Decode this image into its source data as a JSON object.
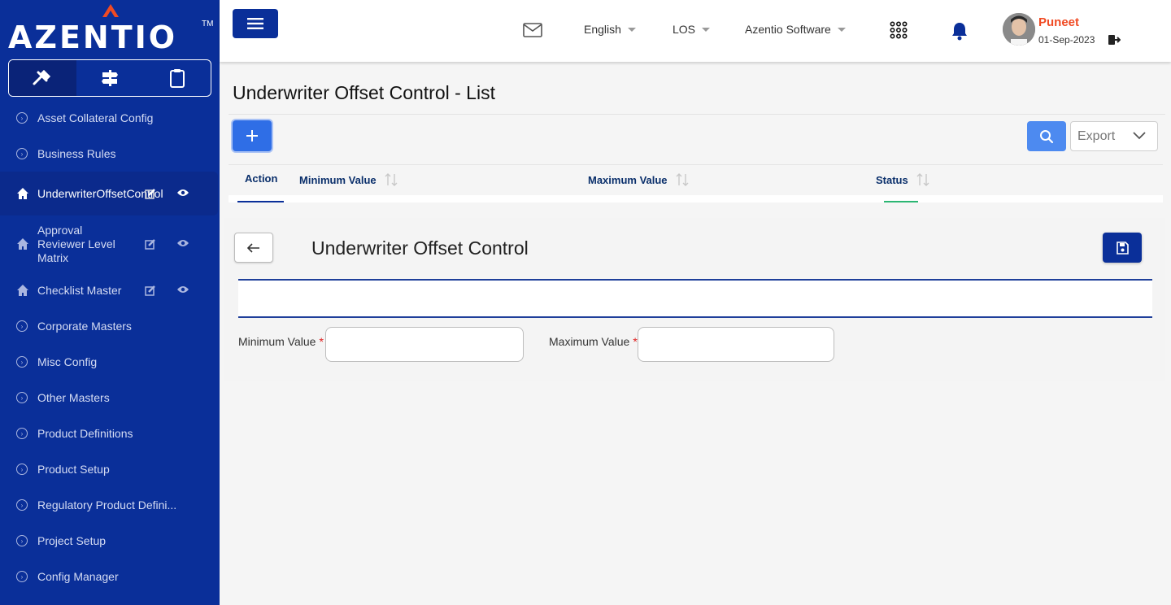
{
  "brand": {
    "name": "AZENTIO",
    "tm": "TM"
  },
  "sidebar": {
    "items": [
      {
        "label": "Asset Collateral Config"
      },
      {
        "label": "Business Rules"
      },
      {
        "label": "UnderwriterOffsetControl"
      },
      {
        "label": "Approval Reviewer Level Matrix"
      },
      {
        "label": "Checklist Master"
      },
      {
        "label": "Corporate Masters"
      },
      {
        "label": "Misc Config"
      },
      {
        "label": "Other Masters"
      },
      {
        "label": "Product Definitions"
      },
      {
        "label": "Product Setup"
      },
      {
        "label": "Regulatory Product Defini..."
      },
      {
        "label": "Project Setup"
      },
      {
        "label": "Config Manager"
      }
    ]
  },
  "header": {
    "language": "English",
    "module": "LOS",
    "company": "Azentio Software",
    "user_name": "Puneet",
    "date": "01-Sep-2023"
  },
  "list": {
    "title": "Underwriter Offset Control - List",
    "export_label": "Export",
    "columns": [
      "Action",
      "Minimum Value",
      "Maximum Value",
      "Status"
    ]
  },
  "form": {
    "title": "Underwriter Offset Control",
    "min_label": "Minimum Value",
    "max_label": "Maximum Value",
    "required_mark": "*",
    "min_value": "",
    "max_value": ""
  },
  "colors": {
    "sidebar": "#0a2f99",
    "accent_orange": "#f04a23",
    "primary_button": "#2f6ee6"
  }
}
